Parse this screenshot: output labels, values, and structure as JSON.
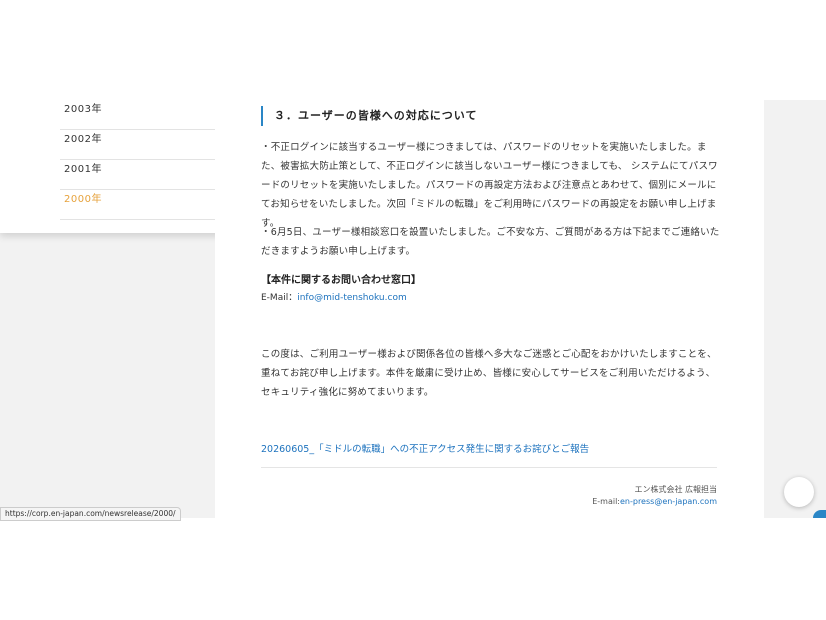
{
  "sidebar": {
    "years": [
      {
        "label": "2003年"
      },
      {
        "label": "2002年"
      },
      {
        "label": "2001年"
      },
      {
        "label": "2000年"
      }
    ]
  },
  "article": {
    "heading": "３．ユーザーの皆様への対応について",
    "para1": "・不正ログインに該当するユーザー様につきましては、パスワードのリセットを実施いたしました。また、被害拡大防止策として、不正ログインに該当しないユーザー様につきましても、 システムにてパスワードのリセットを実施いたしました。パスワードの再設定方法および注意点とあわせて、個別にメールにてお知らせをいたしました。次回「ミドルの転職」をご利用時にパスワードの再設定をお願い申し上げます。",
    "para2": "・6月5日、ユーザー様相談窓口を設置いたしました。ご不安な方、ご質問がある方は下記までご連絡いただきますようお願い申し上げます。",
    "contact_heading": "【本件に関するお問い合わせ窓口】",
    "email_label": "E-Mail：",
    "email": "info@mid-tenshoku.com",
    "closing": "この度は、ご利用ユーザー様および関係各位の皆様へ多大なご迷惑とご心配をおかけいたしますことを、重ねてお詫び申し上げます。本件を厳粛に受け止め、皆様に安心してサービスをご利用いただけるよう、セキュリティ強化に努めてまいります。",
    "link_text": "20260605_「ミドルの転職」への不正アクセス発生に関するお詫びとご報告"
  },
  "footer": {
    "company": "エン株式会社 広報担当",
    "email_label": "E-mail:",
    "email": "en-press@en-japan.com"
  },
  "status_bar": {
    "url": "https://corp.en-japan.com/newsrelease/2000/"
  },
  "colors": {
    "accent": "#2a86c6",
    "link": "#1e73be",
    "active_year": "#e6a23c"
  }
}
